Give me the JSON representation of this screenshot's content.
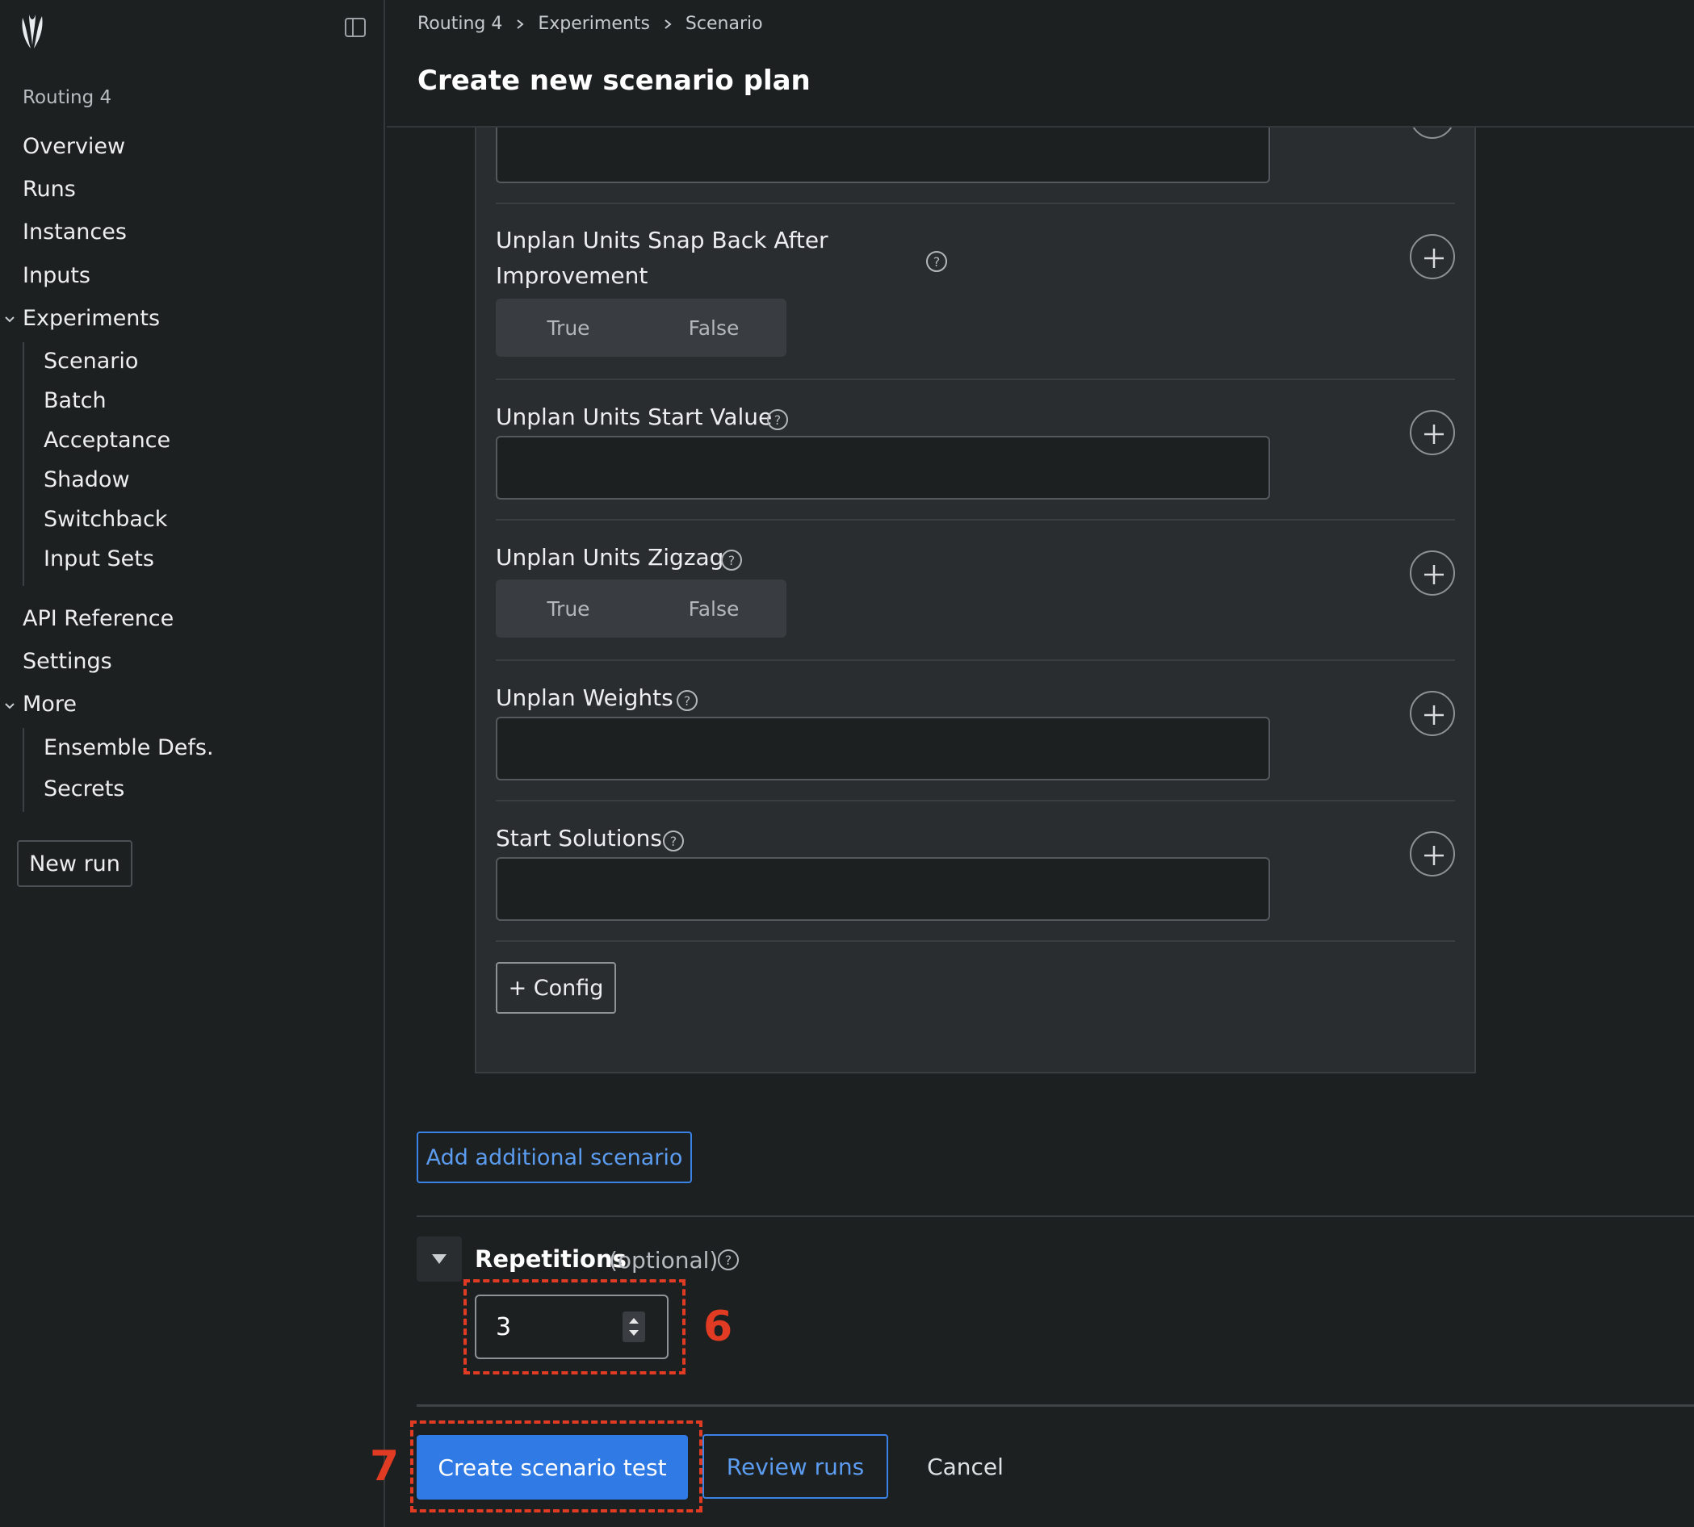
{
  "sidebar": {
    "project_name": "Routing 4",
    "items": {
      "overview": "Overview",
      "runs": "Runs",
      "instances": "Instances",
      "inputs": "Inputs",
      "experiments": "Experiments",
      "api_reference": "API Reference",
      "settings": "Settings",
      "more": "More"
    },
    "experiments_children": [
      "Scenario",
      "Batch",
      "Acceptance",
      "Shadow",
      "Switchback",
      "Input Sets"
    ],
    "more_children": [
      "Ensemble Defs.",
      "Secrets"
    ],
    "new_run_label": "New run"
  },
  "header": {
    "breadcrumbs": [
      "Routing 4",
      "Experiments",
      "Scenario"
    ],
    "title": "Create new scenario plan"
  },
  "scenario": {
    "fields": [
      {
        "label_line1": "Unplan Units Snap Back After",
        "label_line2": "Improvement",
        "type": "toggle",
        "options": [
          "True",
          "False"
        ]
      },
      {
        "label": "Unplan Units Start Value",
        "type": "text",
        "value": ""
      },
      {
        "label": "Unplan Units Zigzag",
        "type": "toggle",
        "options": [
          "True",
          "False"
        ]
      },
      {
        "label": "Unplan Weights",
        "type": "text",
        "value": ""
      },
      {
        "label": "Start Solutions",
        "type": "text",
        "value": ""
      }
    ],
    "add_config_label": "+ Config"
  },
  "add_scenario_label": "Add additional scenario",
  "repetitions": {
    "label": "Repetitions",
    "optional": "(optional)",
    "value": "3"
  },
  "actions": {
    "create": "Create scenario test",
    "review": "Review runs",
    "cancel": "Cancel"
  },
  "annotations": {
    "step6": "6",
    "step7": "7"
  },
  "colors": {
    "background": "#1d2021",
    "panel": "#2a2d30",
    "accent": "#2f7ae5",
    "annotation": "#e23b23"
  }
}
